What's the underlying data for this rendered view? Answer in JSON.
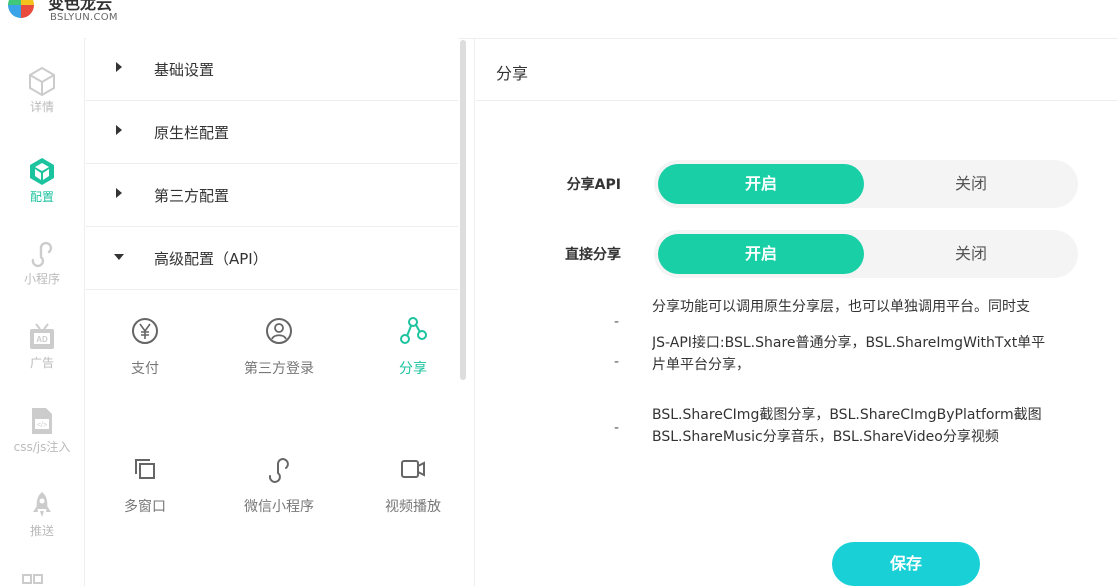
{
  "brand": {
    "name": "变色龙云",
    "domain": "BSLYUN.COM"
  },
  "leftnav": [
    {
      "label": "详情",
      "icon": "cube-icon"
    },
    {
      "label": "配置",
      "icon": "cube-active-icon"
    },
    {
      "label": "小程序",
      "icon": "miniprogram-icon"
    },
    {
      "label": "广告",
      "icon": "ad-icon"
    },
    {
      "label": "css/js注入",
      "icon": "code-file-icon"
    },
    {
      "label": "推送",
      "icon": "rocket-icon"
    }
  ],
  "menu": [
    {
      "label": "基础设置",
      "expanded": false
    },
    {
      "label": "原生栏配置",
      "expanded": false
    },
    {
      "label": "第三方配置",
      "expanded": false
    },
    {
      "label": "高级配置（API）",
      "expanded": true
    }
  ],
  "tools": [
    {
      "label": "支付",
      "icon": "yen-icon"
    },
    {
      "label": "第三方登录",
      "icon": "user-icon"
    },
    {
      "label": "分享",
      "icon": "share-icon"
    },
    {
      "label": "多窗口",
      "icon": "multi-window-icon"
    },
    {
      "label": "微信小程序",
      "icon": "miniprogram-icon"
    },
    {
      "label": "视频播放",
      "icon": "video-icon"
    }
  ],
  "content": {
    "title": "分享",
    "fields": [
      {
        "label": "分享API",
        "on": "开启",
        "off": "关闭",
        "value": "on"
      },
      {
        "label": "直接分享",
        "on": "开启",
        "off": "关闭",
        "value": "on"
      }
    ],
    "descriptions": [
      "分享功能可以调用原生分享层，也可以单独调用平台。同时支",
      "JS-API接口:BSL.Share普通分享，BSL.ShareImgWithTxt单平\n片单平台分享，",
      "BSL.ShareCImg截图分享，BSL.ShareCImgByPlatform截图\nBSL.ShareMusic分享音乐，BSL.ShareVideo分享视频"
    ],
    "dash": "-",
    "save_label": "保存"
  },
  "colors": {
    "accent": "#18cfa6",
    "save": "#18d0d6"
  }
}
